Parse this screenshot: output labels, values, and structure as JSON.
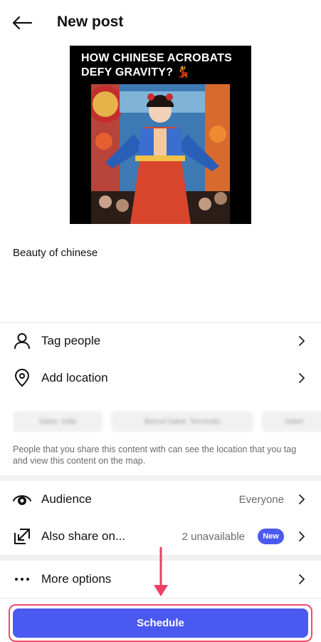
{
  "header": {
    "title": "New post"
  },
  "media": {
    "overlay_text": "HOW CHINESE ACROBATS DEFY GRAVITY? 💃"
  },
  "caption": "Beauty of chinese",
  "rows": {
    "tag_people": "Tag people",
    "add_location": "Add location",
    "audience": {
      "label": "Audience",
      "value": "Everyone"
    },
    "also_share": {
      "label": "Also share on...",
      "value": "2 unavailable",
      "badge": "New"
    },
    "more_options": "More options"
  },
  "location_chips": [
    "Saket, India",
    "Bimcol Saket, Terminals",
    "Saket"
  ],
  "location_info": "People that you share this content with can see the location that you tag and view this content on the map.",
  "schedule": {
    "label": "Schedule"
  },
  "colors": {
    "accent": "#4a5af0",
    "highlight": "#ee4b6a"
  }
}
